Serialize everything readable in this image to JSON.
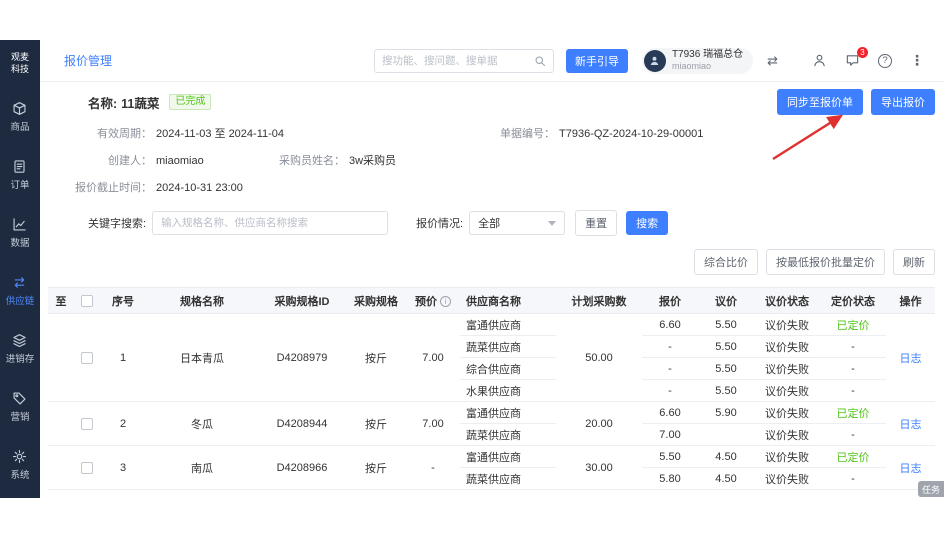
{
  "sidebar": {
    "logo": "观麦科技",
    "items": [
      {
        "key": "goods",
        "label": "商品",
        "icon": "box-icon",
        "active": false
      },
      {
        "key": "orders",
        "label": "订单",
        "icon": "order-icon",
        "active": false
      },
      {
        "key": "data",
        "label": "数据",
        "icon": "chart-icon",
        "active": false
      },
      {
        "key": "supply-chain",
        "label": "供应链",
        "icon": "supply-chain-icon",
        "active": true
      },
      {
        "key": "inventory",
        "label": "进销存",
        "icon": "layers-icon",
        "active": false
      },
      {
        "key": "marketing",
        "label": "营销",
        "icon": "tag-icon",
        "active": false
      },
      {
        "key": "system",
        "label": "系统",
        "icon": "gear-icon",
        "active": false
      }
    ]
  },
  "header": {
    "breadcrumb": "报价管理",
    "search_placeholder": "搜功能、搜问题、搜单据",
    "guide_button": "新手引导",
    "user": {
      "org": "T7936 瑞福总仓",
      "name": "miaomiao"
    },
    "message_badge": "3",
    "icons": {
      "swap": "⇄",
      "help": "?",
      "kebab": "⋮"
    }
  },
  "summary": {
    "name_label": "名称:",
    "name_value": "11蔬菜",
    "status_badge": "已完成",
    "sync_button": "同步至报价单",
    "export_button": "导出报价",
    "fields": [
      {
        "label": "有效周期：",
        "value": "2024-11-03 至 2024-11-04"
      },
      {
        "label": "单据编号：",
        "value": "T7936-QZ-2024-10-29-00001"
      },
      {
        "label": "创建人：",
        "value": "miaomiao"
      },
      {
        "label": "采购员姓名：",
        "value": "3w采购员"
      },
      {
        "label": "报价截止时间：",
        "value": "2024-10-31 23:00"
      }
    ]
  },
  "filters": {
    "keyword_label": "关键字搜索:",
    "keyword_placeholder": "输入规格名称、供应商名称搜索",
    "status_label": "报价情况:",
    "status_value": "全部",
    "reset_button": "重置",
    "search_button": "搜索"
  },
  "toolbar": {
    "compare_button": "综合比价",
    "batch_price_button": "按最低报价批量定价",
    "refresh_button": "刷新"
  },
  "table": {
    "headers": [
      {
        "label": "至"
      },
      {
        "label": "",
        "type": "checkbox"
      },
      {
        "label": "序号"
      },
      {
        "label": "规格名称"
      },
      {
        "label": "采购规格ID"
      },
      {
        "label": "采购规格"
      },
      {
        "label": "预价",
        "info": true
      },
      {
        "label": "供应商名称"
      },
      {
        "label": "计划采购数"
      },
      {
        "label": "报价"
      },
      {
        "label": "议价"
      },
      {
        "label": "议价状态"
      },
      {
        "label": "定价状态"
      },
      {
        "label": "操作"
      }
    ],
    "rows": [
      {
        "seq": "1",
        "spec_name": "日本青瓜",
        "spec_id": "D4208979",
        "purchase_spec": "按斤",
        "base_price": "7.00",
        "plan_qty": "50.00",
        "log": "日志",
        "suppliers": [
          {
            "name": "富通供应商",
            "quote": "6.60",
            "bargain": "5.50",
            "bargain_status": "议价失败",
            "price_status": "已定价"
          },
          {
            "name": "蔬菜供应商",
            "quote": "-",
            "bargain": "5.50",
            "bargain_status": "议价失败",
            "price_status": "-"
          },
          {
            "name": "综合供应商",
            "quote": "-",
            "bargain": "5.50",
            "bargain_status": "议价失败",
            "price_status": "-"
          },
          {
            "name": "水果供应商",
            "quote": "-",
            "bargain": "5.50",
            "bargain_status": "议价失败",
            "price_status": "-"
          }
        ]
      },
      {
        "seq": "2",
        "spec_name": "冬瓜",
        "spec_id": "D4208944",
        "purchase_spec": "按斤",
        "base_price": "7.00",
        "plan_qty": "20.00",
        "log": "日志",
        "suppliers": [
          {
            "name": "富通供应商",
            "quote": "6.60",
            "bargain": "5.90",
            "bargain_status": "议价失败",
            "price_status": "已定价"
          },
          {
            "name": "蔬菜供应商",
            "quote": "7.00",
            "bargain": "",
            "bargain_status": "议价失败",
            "price_status": "-"
          }
        ]
      },
      {
        "seq": "3",
        "spec_name": "南瓜",
        "spec_id": "D4208966",
        "purchase_spec": "按斤",
        "base_price": "-",
        "plan_qty": "30.00",
        "log": "日志",
        "suppliers": [
          {
            "name": "富通供应商",
            "quote": "5.50",
            "bargain": "4.50",
            "bargain_status": "议价失败",
            "price_status": "已定价"
          },
          {
            "name": "蔬菜供应商",
            "quote": "5.80",
            "bargain": "4.50",
            "bargain_status": "议价失败",
            "price_status": "-"
          }
        ]
      }
    ]
  },
  "task_widget": "任务",
  "colors": {
    "primary": "#3d7fff",
    "success": "#52c41a",
    "danger": "#f5222d",
    "arrow": "#e03131",
    "sidebar": "#1e2a3f"
  }
}
